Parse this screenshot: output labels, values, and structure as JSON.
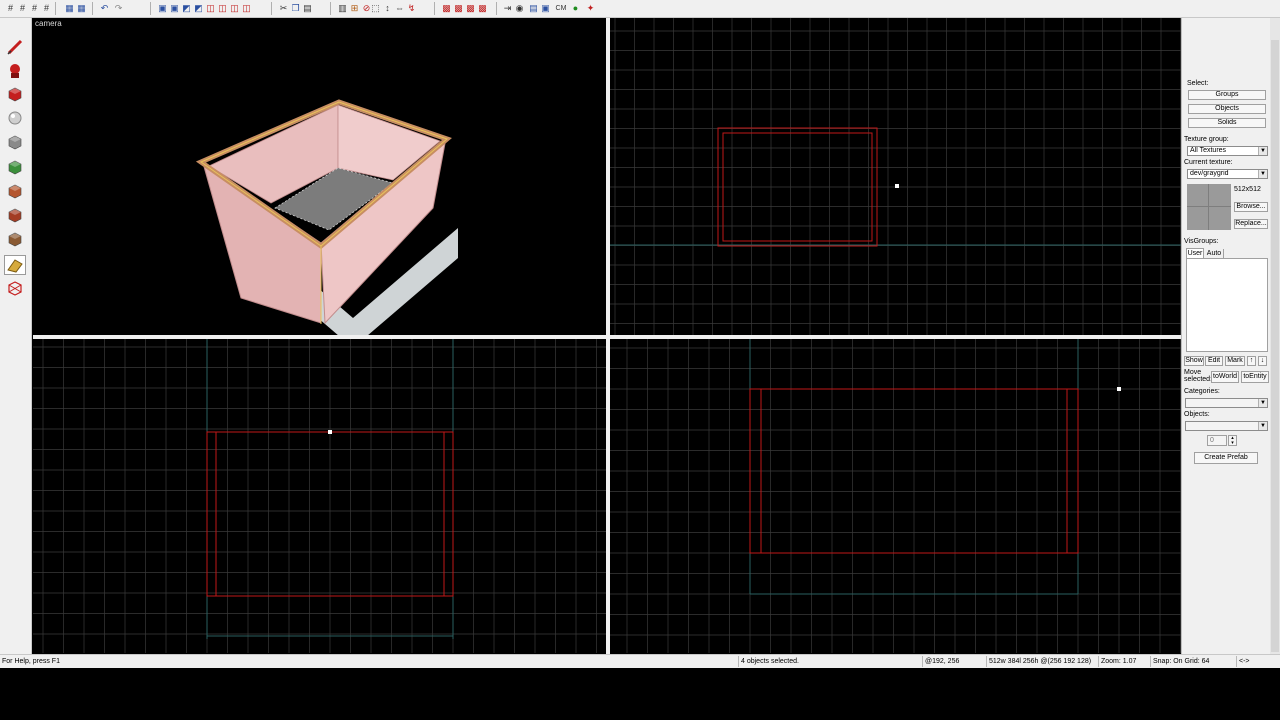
{
  "toolbar": {
    "buttons": [
      {
        "name": "grid-toggle-icon",
        "glyph": "#"
      },
      {
        "name": "grid-3d-icon",
        "glyph": "#"
      },
      {
        "name": "grid-smaller-icon",
        "glyph": "#"
      },
      {
        "name": "grid-larger-icon",
        "glyph": "#"
      },
      {
        "name": "load-window-state-icon",
        "glyph": "▦"
      },
      {
        "name": "save-window-state-icon",
        "glyph": "▦"
      },
      {
        "name": "undo-icon",
        "glyph": "↶"
      },
      {
        "name": "redo-icon",
        "glyph": "↷"
      },
      {
        "name": "group-icon",
        "glyph": "▣"
      },
      {
        "name": "ungroup-icon",
        "glyph": "▣"
      },
      {
        "name": "hide-selected-icon",
        "glyph": "◩"
      },
      {
        "name": "hide-unselected-icon",
        "glyph": "◩"
      },
      {
        "name": "carve-icon",
        "glyph": "◫"
      },
      {
        "name": "hollow-icon",
        "glyph": "◫"
      },
      {
        "name": "texture-lock-icon",
        "glyph": "◫"
      },
      {
        "name": "flip-icon",
        "glyph": "◫"
      },
      {
        "name": "cut-icon",
        "glyph": "✂"
      },
      {
        "name": "copy-icon",
        "glyph": "❐"
      },
      {
        "name": "paste-icon",
        "glyph": "▤"
      },
      {
        "name": "snap-to-grid-icon",
        "glyph": "▥"
      },
      {
        "name": "align-icon",
        "glyph": "⊞"
      },
      {
        "name": "clear-icon",
        "glyph": "⊘"
      },
      {
        "name": "bounding-box-icon",
        "glyph": "⬚"
      },
      {
        "name": "resize-icon",
        "glyph": "↕"
      },
      {
        "name": "arrange-icon",
        "glyph": "⇔"
      },
      {
        "name": "wrap-icon",
        "glyph": "↯"
      },
      {
        "name": "entity-report-icon",
        "glyph": "▩"
      },
      {
        "name": "check-problems-icon",
        "glyph": "▩"
      },
      {
        "name": "compile-icon",
        "glyph": "▩"
      },
      {
        "name": "run-map-icon",
        "glyph": "▩"
      },
      {
        "name": "goto-brush-icon",
        "glyph": "⇥"
      },
      {
        "name": "toggle-models-icon",
        "glyph": "◉"
      },
      {
        "name": "toggle-decals-icon",
        "glyph": "▤"
      },
      {
        "name": "cubemap-icon",
        "glyph": "▣"
      },
      {
        "name": "cm-icon",
        "glyph": "CM"
      },
      {
        "name": "sphere-icon",
        "glyph": "●"
      },
      {
        "name": "fire-icon",
        "glyph": "✦"
      }
    ]
  },
  "tools": [
    {
      "name": "selection-tool-icon",
      "color": "#c41e1e",
      "shape": "pencil"
    },
    {
      "name": "magnify-tool-icon",
      "color": "#c41e1e",
      "shape": "blob"
    },
    {
      "name": "camera-tool-icon",
      "color": "#c41e1e",
      "shape": "box"
    },
    {
      "name": "entity-tool-icon",
      "color": "#cfcfcf",
      "shape": "sphere"
    },
    {
      "name": "block-tool-icon",
      "color": "#8a8a8a",
      "shape": "box"
    },
    {
      "name": "texture-tool-icon",
      "color": "#3b8f3b",
      "shape": "box"
    },
    {
      "name": "apply-texture-icon",
      "color": "#b4562f",
      "shape": "box"
    },
    {
      "name": "decal-tool-icon",
      "color": "#a33c23",
      "shape": "box"
    },
    {
      "name": "overlay-tool-icon",
      "color": "#8a5a33",
      "shape": "box"
    },
    {
      "name": "clip-tool-icon",
      "color": "#d6aa3c",
      "shape": "wedge"
    },
    {
      "name": "vertex-tool-icon",
      "color": "#c41e1e",
      "shape": "cube"
    }
  ],
  "viewports": {
    "camera_label": "camera"
  },
  "right_panel": {
    "select_label": "Select:",
    "groups_button": "Groups",
    "objects_button": "Objects",
    "solids_button": "Solids",
    "texture_group_label": "Texture group:",
    "texture_group_value": "All Textures",
    "current_texture_label": "Current texture:",
    "current_texture_value": "dev/graygrid",
    "texture_size": "512x512",
    "browse_button": "Browse...",
    "replace_button": "Replace...",
    "visgroups_label": "VisGroups:",
    "tab_user": "User",
    "tab_auto": "Auto",
    "show_button": "Show",
    "edit_button": "Edit",
    "mark_button": "Mark",
    "move_selected_label_1": "Move",
    "move_selected_label_2": "selected:",
    "to_world_button": "toWorld",
    "to_entity_button": "toEntity",
    "categories_label": "Categories:",
    "objects_label": "Objects:",
    "stepper_value": "0",
    "create_prefab_button": "Create Prefab"
  },
  "statusbar": {
    "help": "For Help, press F1",
    "selection": "4 objects selected.",
    "position": "@192, 256",
    "size": "512w 384l 256h @(256 192 128)",
    "zoom": "Zoom: 1.07",
    "snap": "Snap: On Grid: 64",
    "extra": "<->"
  },
  "colors": {
    "selection_red": "#c01818",
    "grid": "#3a3a3a",
    "grid_axis": "#2a6060",
    "wall_pink": "#e8b8b8",
    "wall_edge": "#c98858",
    "floor_gray": "#7a7a7a"
  }
}
